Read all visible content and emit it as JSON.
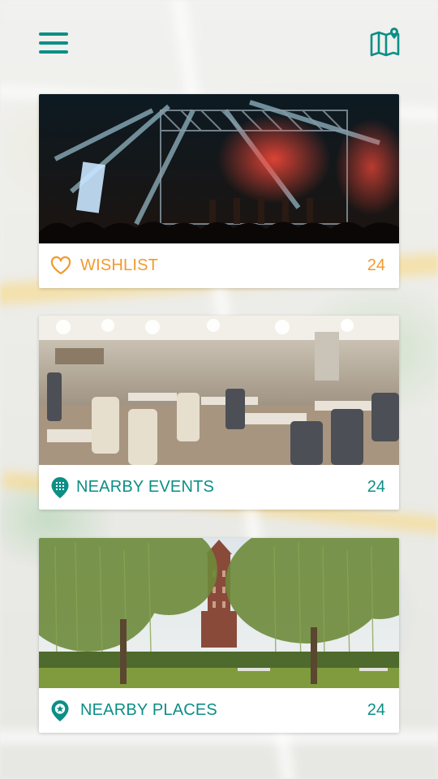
{
  "header": {
    "menu_icon": "hamburger-menu-icon",
    "map_icon": "map-pin-icon"
  },
  "cards": [
    {
      "label": "WISHLIST",
      "count": "24",
      "icon": "heart-icon",
      "color": "#f29a2e",
      "photo": "concert-stage-photo"
    },
    {
      "label": "NEARBY EVENTS",
      "count": "24",
      "icon": "calendar-pin-icon",
      "color": "#0b8f86",
      "photo": "restaurant-hall-photo"
    },
    {
      "label": "NEARBY PLACES",
      "count": "24",
      "icon": "star-pin-icon",
      "color": "#0b8f86",
      "photo": "park-tower-photo"
    }
  ],
  "colors": {
    "accent_teal": "#0b8f86",
    "accent_orange": "#f29a2e"
  }
}
